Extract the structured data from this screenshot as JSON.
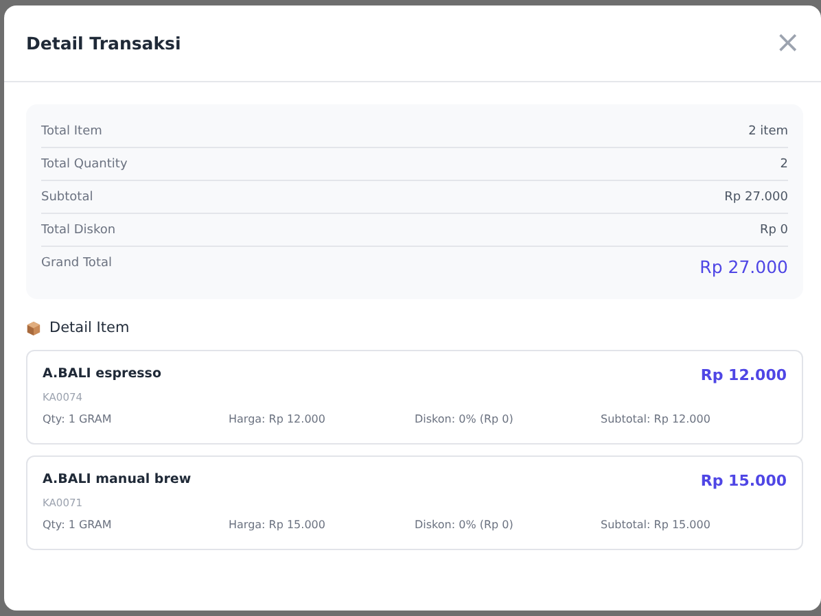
{
  "modal": {
    "title": "Detail Transaksi",
    "close_icon": "×"
  },
  "summary": [
    {
      "label": "Total Item",
      "value": "2 item",
      "kind": "normal"
    },
    {
      "label": "Total Quantity",
      "value": "2",
      "kind": "normal"
    },
    {
      "label": "Subtotal",
      "value": "Rp 27.000",
      "kind": "normal"
    },
    {
      "label": "Total Diskon",
      "value": "Rp 0",
      "kind": "normal"
    },
    {
      "label": "Grand Total",
      "value": "Rp 27.000",
      "kind": "grand"
    }
  ],
  "items_heading": "Detail Item",
  "items": [
    {
      "name": "A.BALI espresso",
      "code": "KA0074",
      "price": "Rp 12.000",
      "qty": "Qty: 1 GRAM",
      "harga": "Harga: Rp 12.000",
      "diskon": "Diskon: 0% (Rp 0)",
      "subtotal": "Subtotal: Rp 12.000"
    },
    {
      "name": "A.BALI manual brew",
      "code": "KA0071",
      "price": "Rp 15.000",
      "qty": "Qty: 1 GRAM",
      "harga": "Harga: Rp 15.000",
      "diskon": "Diskon: 0% (Rp 0)",
      "subtotal": "Subtotal: Rp 15.000"
    }
  ]
}
